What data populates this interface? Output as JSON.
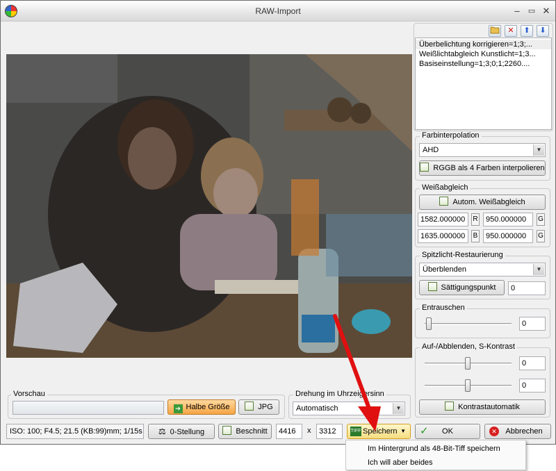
{
  "window": {
    "title": "RAW-Import"
  },
  "presets": {
    "items": [
      "Überbelichtung korrigieren=1;3;...",
      "Weißlichtabgleich Kunstlicht=1;3...",
      "Basiseinstellung=1;3;0;1;2260...."
    ]
  },
  "farbinterpolation": {
    "title": "Farbinterpolation",
    "method": "AHD",
    "rggb_label": "RGGB als 4 Farben interpolieren"
  },
  "weissabgleich": {
    "title": "Weißabgleich",
    "auto_label": "Autom. Weißabgleich",
    "r_value": "1582.000000",
    "r_label": "R",
    "g1_value": "950.000000",
    "g1_label": "G",
    "b_value": "1635.000000",
    "b_label": "B",
    "g2_value": "950.000000",
    "g2_label": "G"
  },
  "spitzlicht": {
    "title": "Spitzlicht-Restaurierung",
    "mode": "Überblenden",
    "saturation_label": "Sättigungspunkt",
    "saturation_value": "0"
  },
  "entrauschen": {
    "title": "Entrauschen",
    "value": "0",
    "level": 0
  },
  "aufabblenden": {
    "title": "Auf-/Abblenden, S-Kontrast",
    "value1": "0",
    "value2": "0",
    "kontrast_label": "Kontrastautomatik"
  },
  "vorschau": {
    "title": "Vorschau",
    "halbe_label": "Halbe Größe",
    "jpg_label": "JPG"
  },
  "drehung": {
    "title": "Drehung im Uhrzeigersinn",
    "value": "Automatisch"
  },
  "bottom": {
    "status": "ISO: 100; F4.5; 21.5 (KB:99)mm; 1/15s",
    "nullstellung_label": "0-Stellung",
    "beschnitt_label": "Beschnitt",
    "width": "4416",
    "x_label": "x",
    "height": "3312",
    "speichern_label": "Speichern",
    "tiff_badge": "TIFF",
    "ok_label": "OK",
    "abbrechen_label": "Abbrechen"
  },
  "menu": {
    "items": [
      "Im Hintergrund als 48-Bit-Tiff speichern",
      "Ich will aber beides"
    ]
  },
  "colors": {
    "arrow": "#e01010",
    "accent": "#f5a443"
  }
}
